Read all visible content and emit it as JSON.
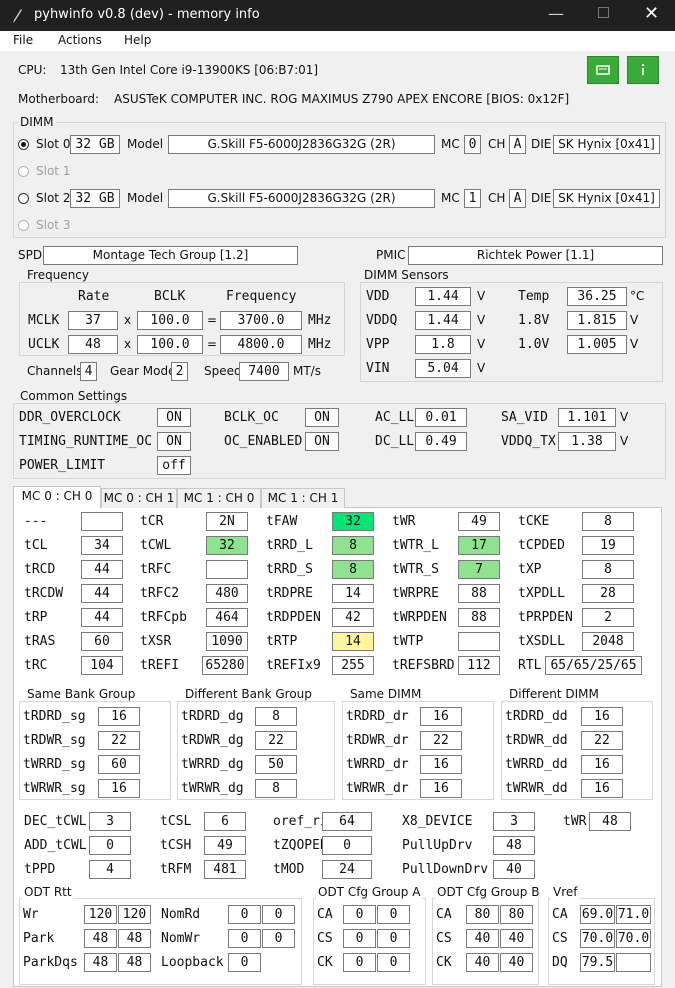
{
  "window": {
    "title": "pyhwinfo v0.8 (dev) - memory info"
  },
  "menu": [
    "File",
    "Actions",
    "Help"
  ],
  "cpu": {
    "label": "CPU:",
    "value": "13th Gen Intel Core i9-13900KS  [06:B7:01]"
  },
  "motherboard": {
    "label": "Motherboard:",
    "value": "ASUSTeK COMPUTER INC. ROG MAXIMUS Z790 APEX ENCORE  [BIOS: 0x12F]"
  },
  "dimm": {
    "title": "DIMM",
    "slots": [
      {
        "label": "Slot 0",
        "selected": true,
        "enabled": true,
        "size": "32 GB",
        "model": "G.Skill  F5-6000J2836G32G  (2R)",
        "mc": "0",
        "ch": "A",
        "die": "SK Hynix [0x41]"
      },
      {
        "label": "Slot 1",
        "selected": false,
        "enabled": false
      },
      {
        "label": "Slot 2",
        "selected": false,
        "enabled": true,
        "size": "32 GB",
        "model": "G.Skill  F5-6000J2836G32G  (2R)",
        "mc": "1",
        "ch": "A",
        "die": "SK Hynix [0x41]"
      },
      {
        "label": "Slot 3",
        "selected": false,
        "enabled": false
      }
    ],
    "model_label": "Model",
    "mc_label": "MC",
    "ch_label": "CH",
    "die_label": "DIE"
  },
  "spd": {
    "label": "SPD",
    "value": "Montage Tech Group [1.2]"
  },
  "pmic": {
    "label": "PMIC",
    "value": "Richtek Power [1.1]"
  },
  "frequency": {
    "title": "Frequency",
    "headers": [
      "Rate",
      "BCLK",
      "Frequency"
    ],
    "mclk": {
      "label": "MCLK",
      "rate": "37",
      "bclk": "100.0",
      "freq": "3700.0",
      "unit": "MHz"
    },
    "uclk": {
      "label": "UCLK",
      "rate": "48",
      "bclk": "100.0",
      "freq": "4800.0",
      "unit": "MHz"
    },
    "x": "x",
    "eq": "=",
    "channels_label": "Channels",
    "channels": "4",
    "gearmode_label": "Gear Mode",
    "gearmode": "2",
    "speed_label": "Speed",
    "speed": "7400",
    "speed_unit": "MT/s"
  },
  "sensors": {
    "title": "DIMM Sensors",
    "items": [
      {
        "label": "VDD",
        "value": "1.44",
        "unit": "V"
      },
      {
        "label": "VDDQ",
        "value": "1.44",
        "unit": "V"
      },
      {
        "label": "VPP",
        "value": "1.8",
        "unit": "V"
      },
      {
        "label": "VIN",
        "value": "5.04",
        "unit": "V"
      },
      {
        "label": "Temp",
        "value": "36.25",
        "unit": "°C"
      },
      {
        "label": "1.8V",
        "value": "1.815",
        "unit": "V"
      },
      {
        "label": "1.0V",
        "value": "1.005",
        "unit": "V"
      }
    ]
  },
  "common": {
    "title": "Common Settings",
    "ddr_oc": {
      "label": "DDR_OVERCLOCK",
      "value": "ON"
    },
    "timing_rt": {
      "label": "TIMING_RUNTIME_OC",
      "value": "ON"
    },
    "power_limit": {
      "label": "POWER_LIMIT",
      "value": "off"
    },
    "bclk_oc": {
      "label": "BCLK_OC",
      "value": "ON"
    },
    "oc_enabled": {
      "label": "OC_ENABLED",
      "value": "ON"
    },
    "ac_ll": {
      "label": "AC_LL",
      "value": "0.01"
    },
    "dc_ll": {
      "label": "DC_LL",
      "value": "0.49"
    },
    "sa_vid": {
      "label": "SA_VID",
      "value": "1.101",
      "unit": "V"
    },
    "vddq_tx": {
      "label": "VDDQ_TX",
      "value": "1.38",
      "unit": "V"
    }
  },
  "tabs": [
    "MC 0 : CH 0",
    "MC 0 : CH 1",
    "MC 1 : CH 0",
    "MC 1 : CH 1"
  ],
  "timings": {
    "c1": [
      [
        "---",
        ""
      ],
      [
        "tCL",
        "34"
      ],
      [
        "tRCD",
        "44"
      ],
      [
        "tRCDW",
        "44"
      ],
      [
        "tRP",
        "44"
      ],
      [
        "tRAS",
        "60"
      ],
      [
        "tRC",
        "104"
      ]
    ],
    "c2": [
      [
        "tCR",
        "2N"
      ],
      [
        "tCWL",
        "32"
      ],
      [
        "tRFC",
        ""
      ],
      [
        "tRFC2",
        "480"
      ],
      [
        "tRFCpb",
        "464"
      ],
      [
        "tXSR",
        "1090"
      ],
      [
        "tREFI",
        "65280"
      ]
    ],
    "c3": [
      [
        "tFAW",
        "32"
      ],
      [
        "tRRD_L",
        "8"
      ],
      [
        "tRRD_S",
        "8"
      ],
      [
        "tRDPRE",
        "14"
      ],
      [
        "tRDPDEN",
        "42"
      ],
      [
        "tRTP",
        "14"
      ],
      [
        "tREFIx9",
        "255"
      ]
    ],
    "c4": [
      [
        "tWR",
        "49"
      ],
      [
        "tWTR_L",
        "17"
      ],
      [
        "tWTR_S",
        "7"
      ],
      [
        "tWRPRE",
        "88"
      ],
      [
        "tWRPDEN",
        "88"
      ],
      [
        "tWTP",
        ""
      ],
      [
        "tREFSBRD",
        "112"
      ]
    ],
    "c5": [
      [
        "tCKE",
        "8"
      ],
      [
        "tCPDED",
        "19"
      ],
      [
        "tXP",
        "8"
      ],
      [
        "tXPDLL",
        "28"
      ],
      [
        "tPRPDEN",
        "2"
      ],
      [
        "tXSDLL",
        "2048"
      ],
      [
        "RTL",
        "65/65/25/65"
      ]
    ]
  },
  "groups": {
    "sg": {
      "title": "Same Bank Group",
      "items": [
        [
          "tRDRD_sg",
          "16"
        ],
        [
          "tRDWR_sg",
          "22"
        ],
        [
          "tWRRD_sg",
          "60"
        ],
        [
          "tWRWR_sg",
          "16"
        ]
      ]
    },
    "dg": {
      "title": "Different Bank Group",
      "items": [
        [
          "tRDRD_dg",
          "8"
        ],
        [
          "tRDWR_dg",
          "22"
        ],
        [
          "tWRRD_dg",
          "50"
        ],
        [
          "tWRWR_dg",
          "8"
        ]
      ]
    },
    "dr": {
      "title": "Same DIMM",
      "items": [
        [
          "tRDRD_dr",
          "16"
        ],
        [
          "tRDWR_dr",
          "22"
        ],
        [
          "tWRRD_dr",
          "16"
        ],
        [
          "tWRWR_dr",
          "16"
        ]
      ]
    },
    "dd": {
      "title": "Different DIMM",
      "items": [
        [
          "tRDRD_dd",
          "16"
        ],
        [
          "tRDWR_dd",
          "22"
        ],
        [
          "tWRRD_dd",
          "16"
        ],
        [
          "tWRWR_dd",
          "16"
        ]
      ]
    }
  },
  "misc": {
    "r1": [
      [
        "DEC_tCWL",
        "3"
      ],
      [
        "tCSL",
        "6"
      ],
      [
        "oref_ri",
        "64"
      ],
      [
        "X8_DEVICE",
        "3"
      ],
      [
        "tWR",
        "48"
      ]
    ],
    "r2": [
      [
        "ADD_tCWL",
        "0"
      ],
      [
        "tCSH",
        "49"
      ],
      [
        "tZQOPER",
        "0"
      ],
      [
        "PullUpDrv",
        "48"
      ]
    ],
    "r3": [
      [
        "tPPD",
        "4"
      ],
      [
        "tRFM",
        "481"
      ],
      [
        "tMOD",
        "24"
      ],
      [
        "PullDownDrv",
        "40"
      ]
    ]
  },
  "odt": {
    "title": "ODT Rtt",
    "rows": [
      [
        "Wr",
        "120",
        "120",
        "NomRd",
        "0",
        "0"
      ],
      [
        "Park",
        "48",
        "48",
        "NomWr",
        "0",
        "0"
      ],
      [
        "ParkDqs",
        "48",
        "48",
        "Loopback",
        "0",
        ""
      ]
    ]
  },
  "odt_a": {
    "title": "ODT Cfg Group A",
    "rows": [
      [
        "CA",
        "0",
        "0"
      ],
      [
        "CS",
        "0",
        "0"
      ],
      [
        "CK",
        "0",
        "0"
      ]
    ]
  },
  "odt_b": {
    "title": "ODT Cfg Group B",
    "rows": [
      [
        "CA",
        "80",
        "80"
      ],
      [
        "CS",
        "40",
        "40"
      ],
      [
        "CK",
        "40",
        "40"
      ]
    ]
  },
  "vref": {
    "title": "Vref",
    "rows": [
      [
        "CA",
        "69.0",
        "71.0"
      ],
      [
        "CS",
        "70.0",
        "70.0"
      ],
      [
        "DQ",
        "79.5",
        ""
      ]
    ]
  },
  "colors": {
    "highlight_green": "#00e676",
    "light_green": "#8fe28f",
    "highlight_yellow": "#fff59a",
    "button_green": "#3aaa3a"
  },
  "icons": {
    "app": "quill-icon",
    "btn1": "id-card-icon",
    "btn2": "info-icon"
  }
}
